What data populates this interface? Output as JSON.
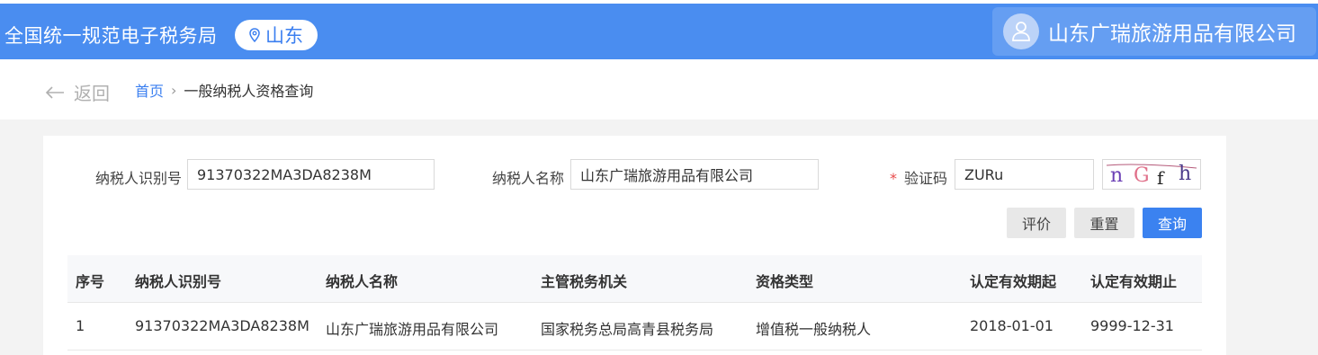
{
  "header": {
    "site_title": "全国统一规范电子税务局",
    "region": "山东",
    "company_name": "山东广瑞旅游用品有限公司"
  },
  "breadcrumb": {
    "back_label": "返回",
    "home": "首页",
    "separator": "›",
    "current": "一般纳税人资格查询"
  },
  "form": {
    "taxpayer_id_label": "纳税人识别号",
    "taxpayer_id_value": "91370322MA3DA8238M",
    "taxpayer_name_label": "纳税人名称",
    "taxpayer_name_value": "山东广瑞旅游用品有限公司",
    "captcha_required": "*",
    "captcha_label": "验证码",
    "captcha_value": "ZURu",
    "captcha_image_text": "nGfh"
  },
  "buttons": {
    "evaluate": "评价",
    "reset": "重置",
    "query": "查询"
  },
  "table": {
    "columns": [
      "序号",
      "纳税人识别号",
      "纳税人名称",
      "主管税务机关",
      "资格类型",
      "认定有效期起",
      "认定有效期止"
    ],
    "rows": [
      [
        "1",
        "91370322MA3DA8238M",
        "山东广瑞旅游用品有限公司",
        "国家税务总局高青县税务局",
        "增值税一般纳税人",
        "2018-01-01",
        "9999-12-31"
      ]
    ]
  },
  "colors": {
    "header_blue": "#4a8df0",
    "link_blue": "#3b7ff0",
    "required_red": "#e84a4a"
  }
}
